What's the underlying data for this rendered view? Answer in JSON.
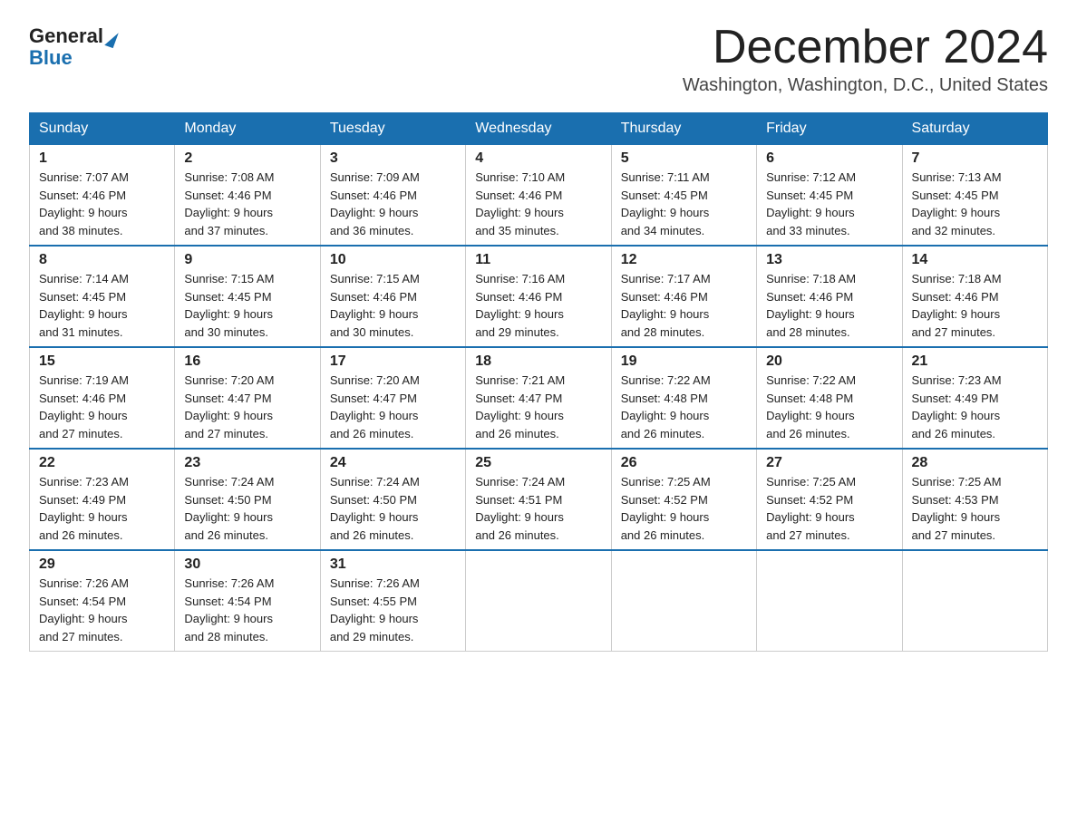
{
  "logo": {
    "general": "General",
    "blue": "Blue"
  },
  "title": "December 2024",
  "location": "Washington, Washington, D.C., United States",
  "days_of_week": [
    "Sunday",
    "Monday",
    "Tuesday",
    "Wednesday",
    "Thursday",
    "Friday",
    "Saturday"
  ],
  "weeks": [
    [
      {
        "day": "1",
        "sunrise": "7:07 AM",
        "sunset": "4:46 PM",
        "daylight": "9 hours and 38 minutes."
      },
      {
        "day": "2",
        "sunrise": "7:08 AM",
        "sunset": "4:46 PM",
        "daylight": "9 hours and 37 minutes."
      },
      {
        "day": "3",
        "sunrise": "7:09 AM",
        "sunset": "4:46 PM",
        "daylight": "9 hours and 36 minutes."
      },
      {
        "day": "4",
        "sunrise": "7:10 AM",
        "sunset": "4:46 PM",
        "daylight": "9 hours and 35 minutes."
      },
      {
        "day": "5",
        "sunrise": "7:11 AM",
        "sunset": "4:45 PM",
        "daylight": "9 hours and 34 minutes."
      },
      {
        "day": "6",
        "sunrise": "7:12 AM",
        "sunset": "4:45 PM",
        "daylight": "9 hours and 33 minutes."
      },
      {
        "day": "7",
        "sunrise": "7:13 AM",
        "sunset": "4:45 PM",
        "daylight": "9 hours and 32 minutes."
      }
    ],
    [
      {
        "day": "8",
        "sunrise": "7:14 AM",
        "sunset": "4:45 PM",
        "daylight": "9 hours and 31 minutes."
      },
      {
        "day": "9",
        "sunrise": "7:15 AM",
        "sunset": "4:45 PM",
        "daylight": "9 hours and 30 minutes."
      },
      {
        "day": "10",
        "sunrise": "7:15 AM",
        "sunset": "4:46 PM",
        "daylight": "9 hours and 30 minutes."
      },
      {
        "day": "11",
        "sunrise": "7:16 AM",
        "sunset": "4:46 PM",
        "daylight": "9 hours and 29 minutes."
      },
      {
        "day": "12",
        "sunrise": "7:17 AM",
        "sunset": "4:46 PM",
        "daylight": "9 hours and 28 minutes."
      },
      {
        "day": "13",
        "sunrise": "7:18 AM",
        "sunset": "4:46 PM",
        "daylight": "9 hours and 28 minutes."
      },
      {
        "day": "14",
        "sunrise": "7:18 AM",
        "sunset": "4:46 PM",
        "daylight": "9 hours and 27 minutes."
      }
    ],
    [
      {
        "day": "15",
        "sunrise": "7:19 AM",
        "sunset": "4:46 PM",
        "daylight": "9 hours and 27 minutes."
      },
      {
        "day": "16",
        "sunrise": "7:20 AM",
        "sunset": "4:47 PM",
        "daylight": "9 hours and 27 minutes."
      },
      {
        "day": "17",
        "sunrise": "7:20 AM",
        "sunset": "4:47 PM",
        "daylight": "9 hours and 26 minutes."
      },
      {
        "day": "18",
        "sunrise": "7:21 AM",
        "sunset": "4:47 PM",
        "daylight": "9 hours and 26 minutes."
      },
      {
        "day": "19",
        "sunrise": "7:22 AM",
        "sunset": "4:48 PM",
        "daylight": "9 hours and 26 minutes."
      },
      {
        "day": "20",
        "sunrise": "7:22 AM",
        "sunset": "4:48 PM",
        "daylight": "9 hours and 26 minutes."
      },
      {
        "day": "21",
        "sunrise": "7:23 AM",
        "sunset": "4:49 PM",
        "daylight": "9 hours and 26 minutes."
      }
    ],
    [
      {
        "day": "22",
        "sunrise": "7:23 AM",
        "sunset": "4:49 PM",
        "daylight": "9 hours and 26 minutes."
      },
      {
        "day": "23",
        "sunrise": "7:24 AM",
        "sunset": "4:50 PM",
        "daylight": "9 hours and 26 minutes."
      },
      {
        "day": "24",
        "sunrise": "7:24 AM",
        "sunset": "4:50 PM",
        "daylight": "9 hours and 26 minutes."
      },
      {
        "day": "25",
        "sunrise": "7:24 AM",
        "sunset": "4:51 PM",
        "daylight": "9 hours and 26 minutes."
      },
      {
        "day": "26",
        "sunrise": "7:25 AM",
        "sunset": "4:52 PM",
        "daylight": "9 hours and 26 minutes."
      },
      {
        "day": "27",
        "sunrise": "7:25 AM",
        "sunset": "4:52 PM",
        "daylight": "9 hours and 27 minutes."
      },
      {
        "day": "28",
        "sunrise": "7:25 AM",
        "sunset": "4:53 PM",
        "daylight": "9 hours and 27 minutes."
      }
    ],
    [
      {
        "day": "29",
        "sunrise": "7:26 AM",
        "sunset": "4:54 PM",
        "daylight": "9 hours and 27 minutes."
      },
      {
        "day": "30",
        "sunrise": "7:26 AM",
        "sunset": "4:54 PM",
        "daylight": "9 hours and 28 minutes."
      },
      {
        "day": "31",
        "sunrise": "7:26 AM",
        "sunset": "4:55 PM",
        "daylight": "9 hours and 29 minutes."
      },
      null,
      null,
      null,
      null
    ]
  ],
  "label_sunrise": "Sunrise:",
  "label_sunset": "Sunset:",
  "label_daylight": "Daylight:"
}
